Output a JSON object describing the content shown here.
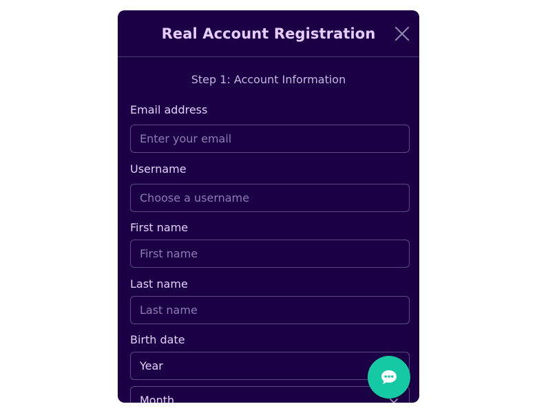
{
  "modal": {
    "title": "Real Account Registration",
    "step": "Step 1: Account Information"
  },
  "form": {
    "email": {
      "label": "Email address",
      "placeholder": "Enter your email"
    },
    "username": {
      "label": "Username",
      "placeholder": "Choose a username"
    },
    "first_name": {
      "label": "First name",
      "placeholder": "First name"
    },
    "last_name": {
      "label": "Last name",
      "placeholder": "Last name"
    },
    "birth_date": {
      "label": "Birth date",
      "year": "Year",
      "month": "Month"
    }
  },
  "icons": {
    "close": "close-icon",
    "chevron": "chevron-down-icon",
    "chat": "chat-bubble-icon"
  },
  "colors": {
    "modal_bg": "#1b0046",
    "title": "#e6ccff",
    "chat_fab": "#14c9a4"
  }
}
